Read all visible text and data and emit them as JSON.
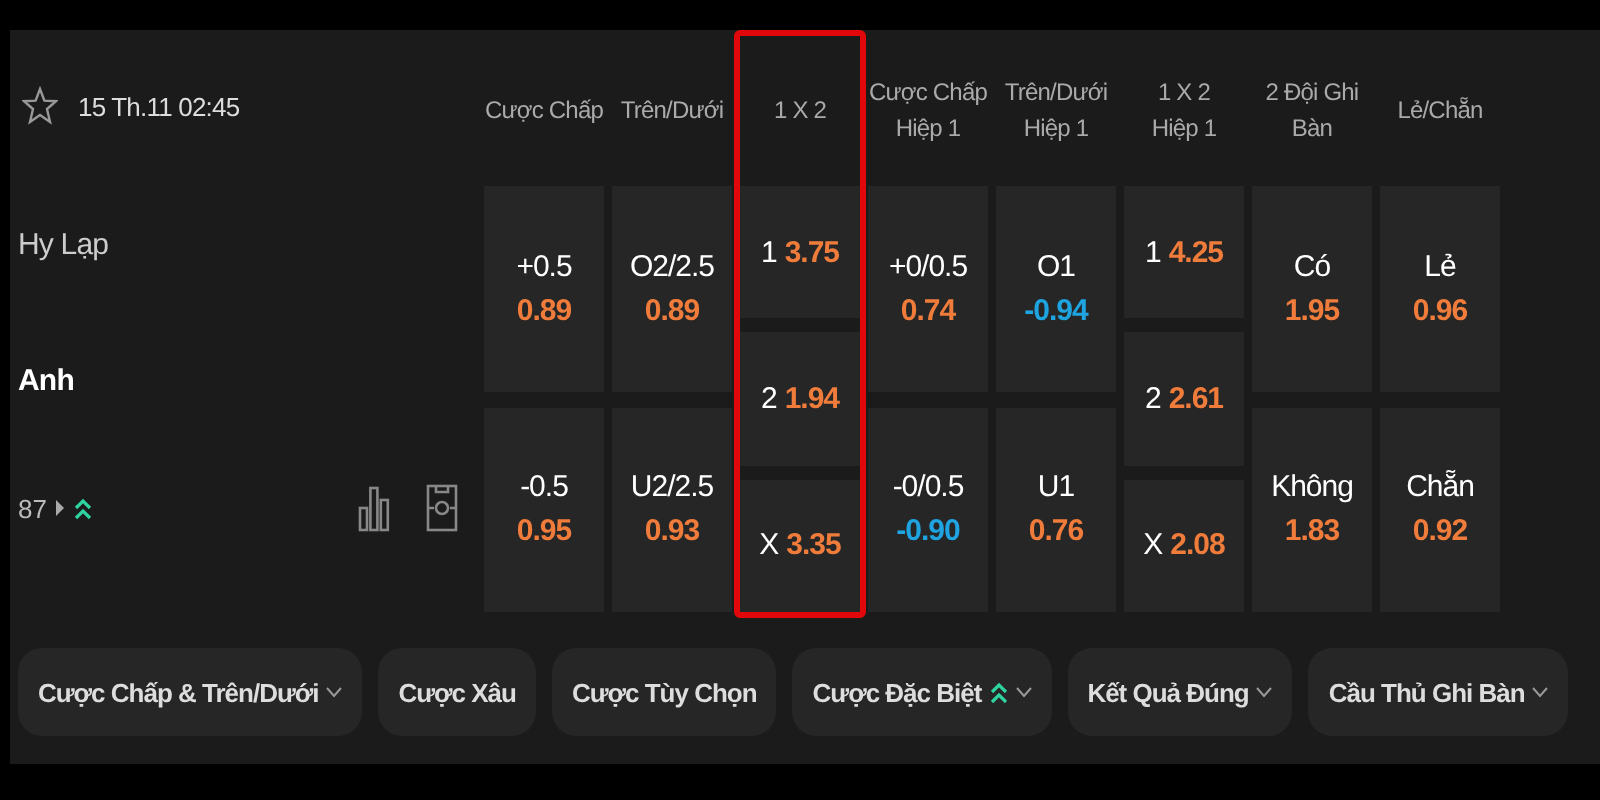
{
  "match": {
    "time": "15 Th.11 02:45",
    "favorite": false,
    "teams": [
      {
        "name": "Hy Lạp",
        "emphasized": false
      },
      {
        "name": "Anh",
        "emphasized": true
      }
    ],
    "minute": "87",
    "trending": true
  },
  "markets": [
    {
      "kind": "pair",
      "header": [
        "Cược Chấp"
      ],
      "highlighted": false,
      "cells": [
        {
          "line": "+0.5",
          "odds": "0.89",
          "color": "#f07c3c"
        },
        {
          "line": "-0.5",
          "odds": "0.95",
          "color": "#f07c3c"
        }
      ]
    },
    {
      "kind": "pair",
      "header": [
        "Trên/Dưới"
      ],
      "highlighted": false,
      "cells": [
        {
          "line": "O2/2.5",
          "odds": "0.89",
          "color": "#f07c3c"
        },
        {
          "line": "U2/2.5",
          "odds": "0.93",
          "color": "#f07c3c"
        }
      ]
    },
    {
      "kind": "triple",
      "header": [
        "1 X 2"
      ],
      "highlighted": true,
      "cells": [
        {
          "line": "1",
          "odds": "3.75",
          "color": "#f07c3c"
        },
        {
          "line": "2",
          "odds": "1.94",
          "color": "#f07c3c"
        },
        {
          "line": "X",
          "odds": "3.35",
          "color": "#f07c3c"
        }
      ]
    },
    {
      "kind": "pair",
      "header": [
        "Cược Chấp",
        "Hiệp 1"
      ],
      "highlighted": false,
      "cells": [
        {
          "line": "+0/0.5",
          "odds": "0.74",
          "color": "#f07c3c"
        },
        {
          "line": "-0/0.5",
          "odds": "-0.90",
          "color": "#1ea4e0"
        }
      ]
    },
    {
      "kind": "pair",
      "header": [
        "Trên/Dưới",
        "Hiệp 1"
      ],
      "highlighted": false,
      "cells": [
        {
          "line": "O1",
          "odds": "-0.94",
          "color": "#1ea4e0"
        },
        {
          "line": "U1",
          "odds": "0.76",
          "color": "#f07c3c"
        }
      ]
    },
    {
      "kind": "triple",
      "header": [
        "1 X 2",
        "Hiệp 1"
      ],
      "highlighted": false,
      "cells": [
        {
          "line": "1",
          "odds": "4.25",
          "color": "#f07c3c"
        },
        {
          "line": "2",
          "odds": "2.61",
          "color": "#f07c3c"
        },
        {
          "line": "X",
          "odds": "2.08",
          "color": "#f07c3c"
        }
      ]
    },
    {
      "kind": "pair",
      "header": [
        "2 Đội Ghi Bàn"
      ],
      "highlighted": false,
      "cells": [
        {
          "line": "Có",
          "odds": "1.95",
          "color": "#f07c3c"
        },
        {
          "line": "Không",
          "odds": "1.83",
          "color": "#f07c3c"
        }
      ]
    },
    {
      "kind": "pair",
      "header": [
        "Lẻ/Chẵn"
      ],
      "highlighted": false,
      "cells": [
        {
          "line": "Lẻ",
          "odds": "0.96",
          "color": "#f07c3c"
        },
        {
          "line": "Chẵn",
          "odds": "0.92",
          "color": "#f07c3c"
        }
      ]
    }
  ],
  "filters": [
    {
      "label": "Cược Chấp & Trên/Dưới",
      "dropdown": true,
      "boost": false
    },
    {
      "label": "Cược Xâu",
      "dropdown": false,
      "boost": false
    },
    {
      "label": "Cược Tùy Chọn",
      "dropdown": false,
      "boost": false
    },
    {
      "label": "Cược Đặc Biệt",
      "dropdown": true,
      "boost": true
    },
    {
      "label": "Kết Quả Đúng",
      "dropdown": true,
      "boost": false
    },
    {
      "label": "Cầu Thủ Ghi Bàn",
      "dropdown": true,
      "boost": false
    }
  ]
}
